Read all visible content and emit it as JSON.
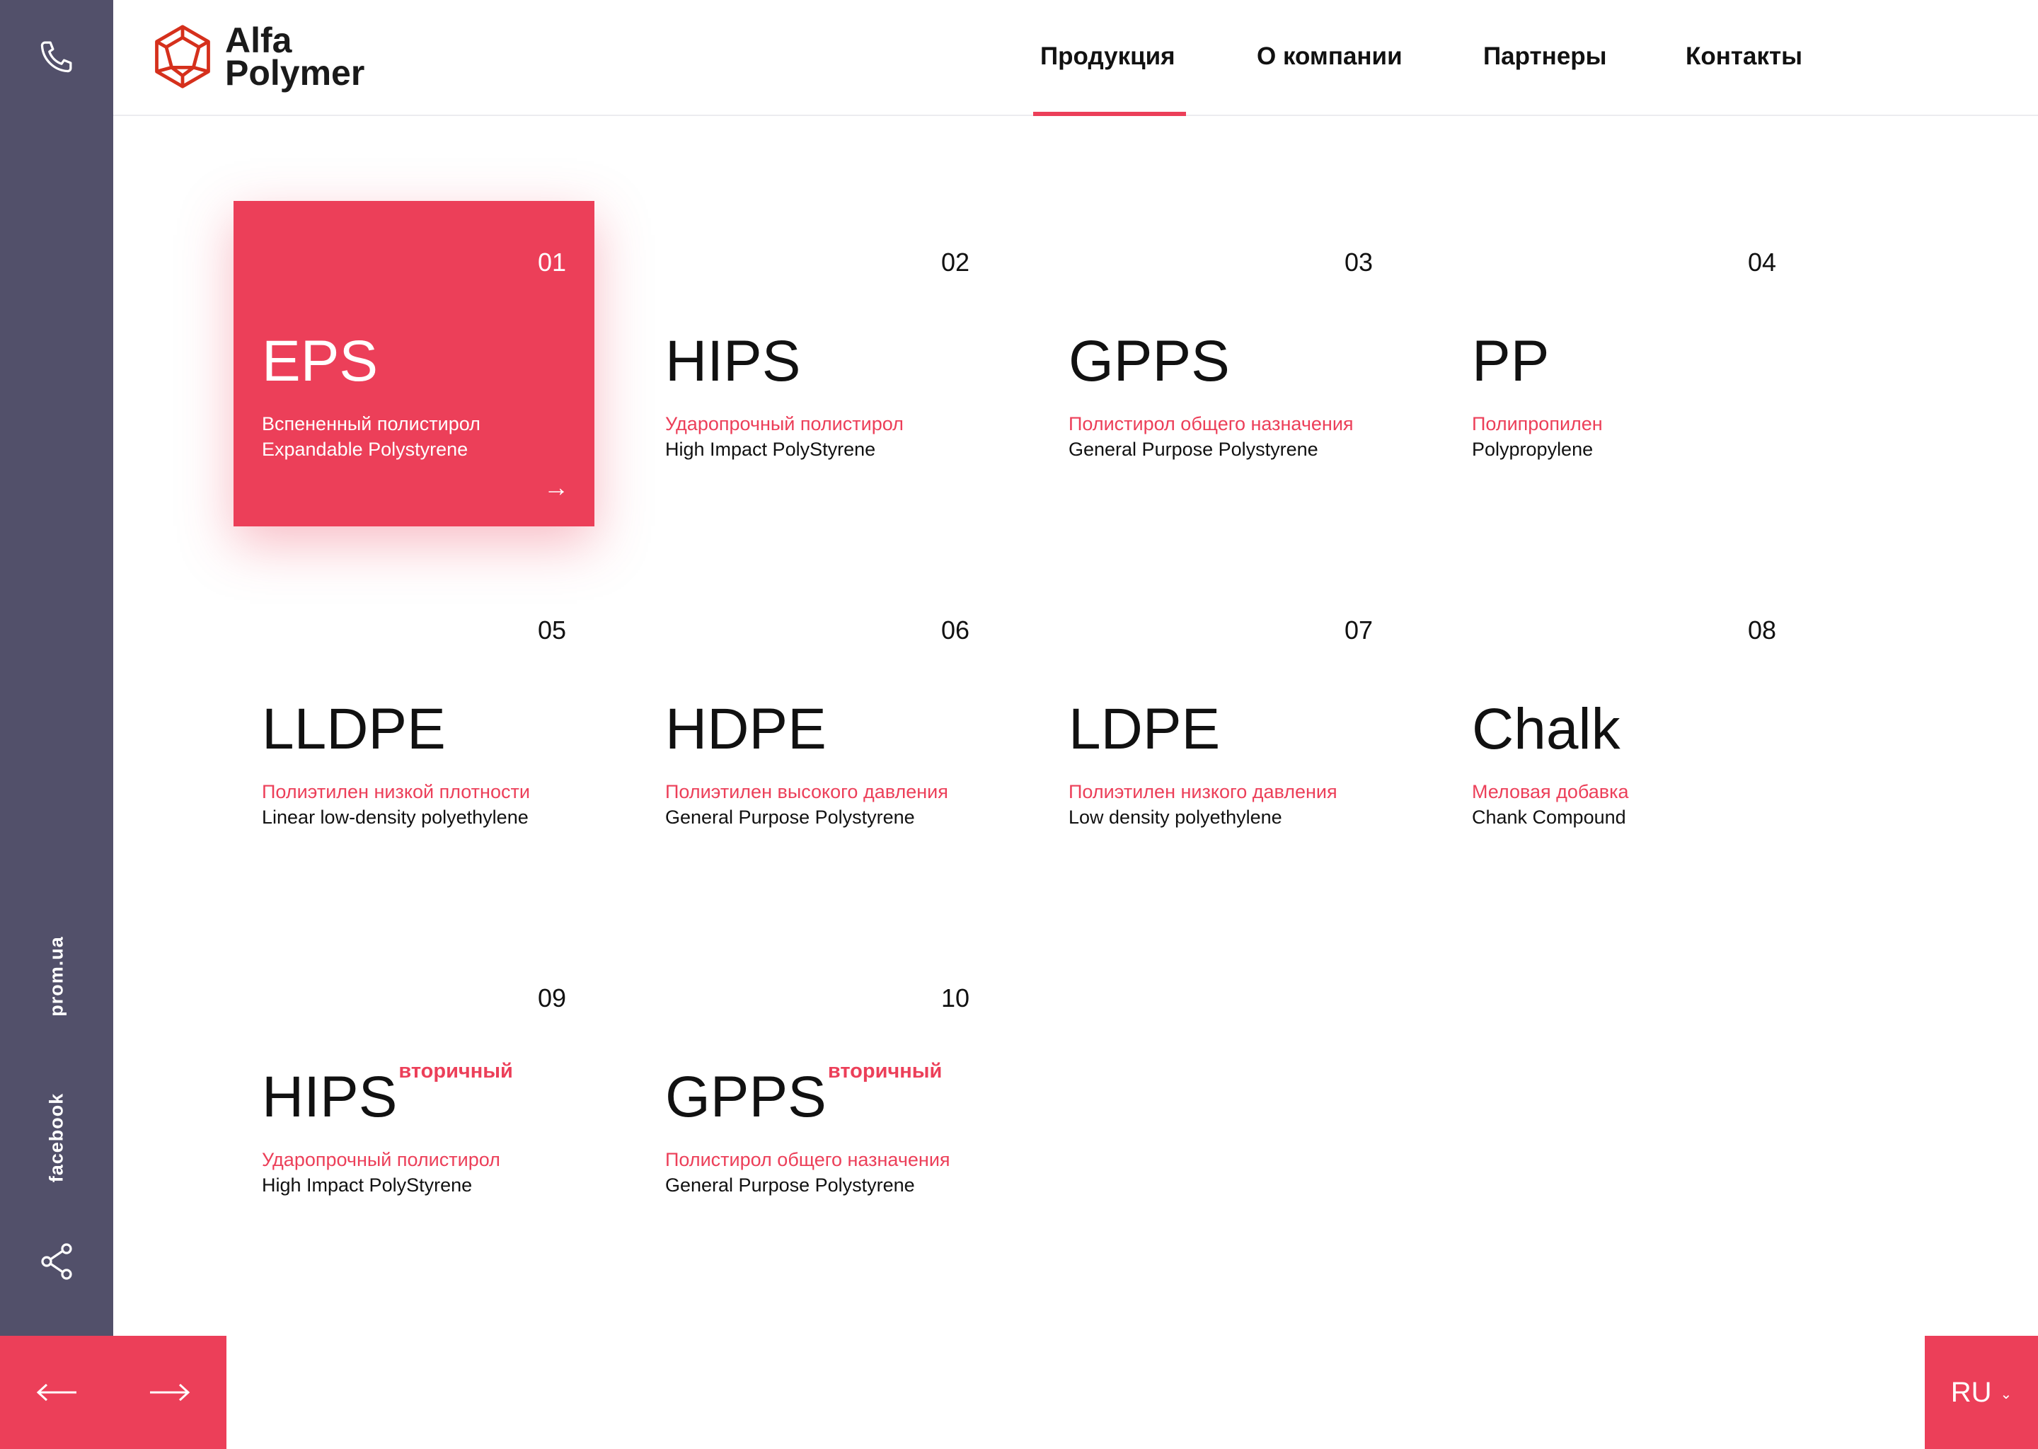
{
  "brand": {
    "line1": "Alfa",
    "line2": "Polymer"
  },
  "nav": {
    "items": [
      "Продукция",
      "О компании",
      "Партнеры",
      "Контакты"
    ],
    "active": "Продукция"
  },
  "sidebar": {
    "links": [
      "prom.ua",
      "facebook"
    ]
  },
  "language": "RU",
  "products": [
    {
      "num": "01",
      "code": "EPS",
      "ru": "Вспененный полистирол",
      "en": "Expandable Polystyrene",
      "tag": "",
      "active": true
    },
    {
      "num": "02",
      "code": "HIPS",
      "ru": "Ударопрочный полистирол",
      "en": "High Impact PolyStyrene",
      "tag": ""
    },
    {
      "num": "03",
      "code": "GPPS",
      "ru": "Полистирол общего назначения",
      "en": "General Purpose Polystyrene",
      "tag": ""
    },
    {
      "num": "04",
      "code": "PP",
      "ru": "Полипропилен",
      "en": "Polypropylene",
      "tag": ""
    },
    {
      "num": "05",
      "code": "LLDPE",
      "ru": "Полиэтилен низкой плотности",
      "en": "Linear low-density polyethylene",
      "tag": ""
    },
    {
      "num": "06",
      "code": "HDPE",
      "ru": "Полиэтилен высокого давления",
      "en": "General Purpose Polystyrene",
      "tag": ""
    },
    {
      "num": "07",
      "code": "LDPE",
      "ru": "Полиэтилен низкого давления",
      "en": "Low density polyethylene",
      "tag": ""
    },
    {
      "num": "08",
      "code": "Chalk",
      "ru": "Меловая добавка",
      "en": "Chank Compound",
      "tag": ""
    },
    {
      "num": "09",
      "code": "HIPS",
      "ru": "Ударопрочный полистирол",
      "en": "High Impact PolyStyrene",
      "tag": "вторичный"
    },
    {
      "num": "10",
      "code": "GPPS",
      "ru": "Полистирол общего назначения",
      "en": "General Purpose Polystyrene",
      "tag": "вторичный"
    }
  ],
  "colors": {
    "accent": "#ec3f59",
    "sidebar": "#52506a",
    "text": "#111111"
  },
  "icons": {
    "call": "phone-icon",
    "share": "share-icon",
    "prev": "arrow-left-icon",
    "next": "arrow-right-icon",
    "open": "arrow-right-icon"
  }
}
